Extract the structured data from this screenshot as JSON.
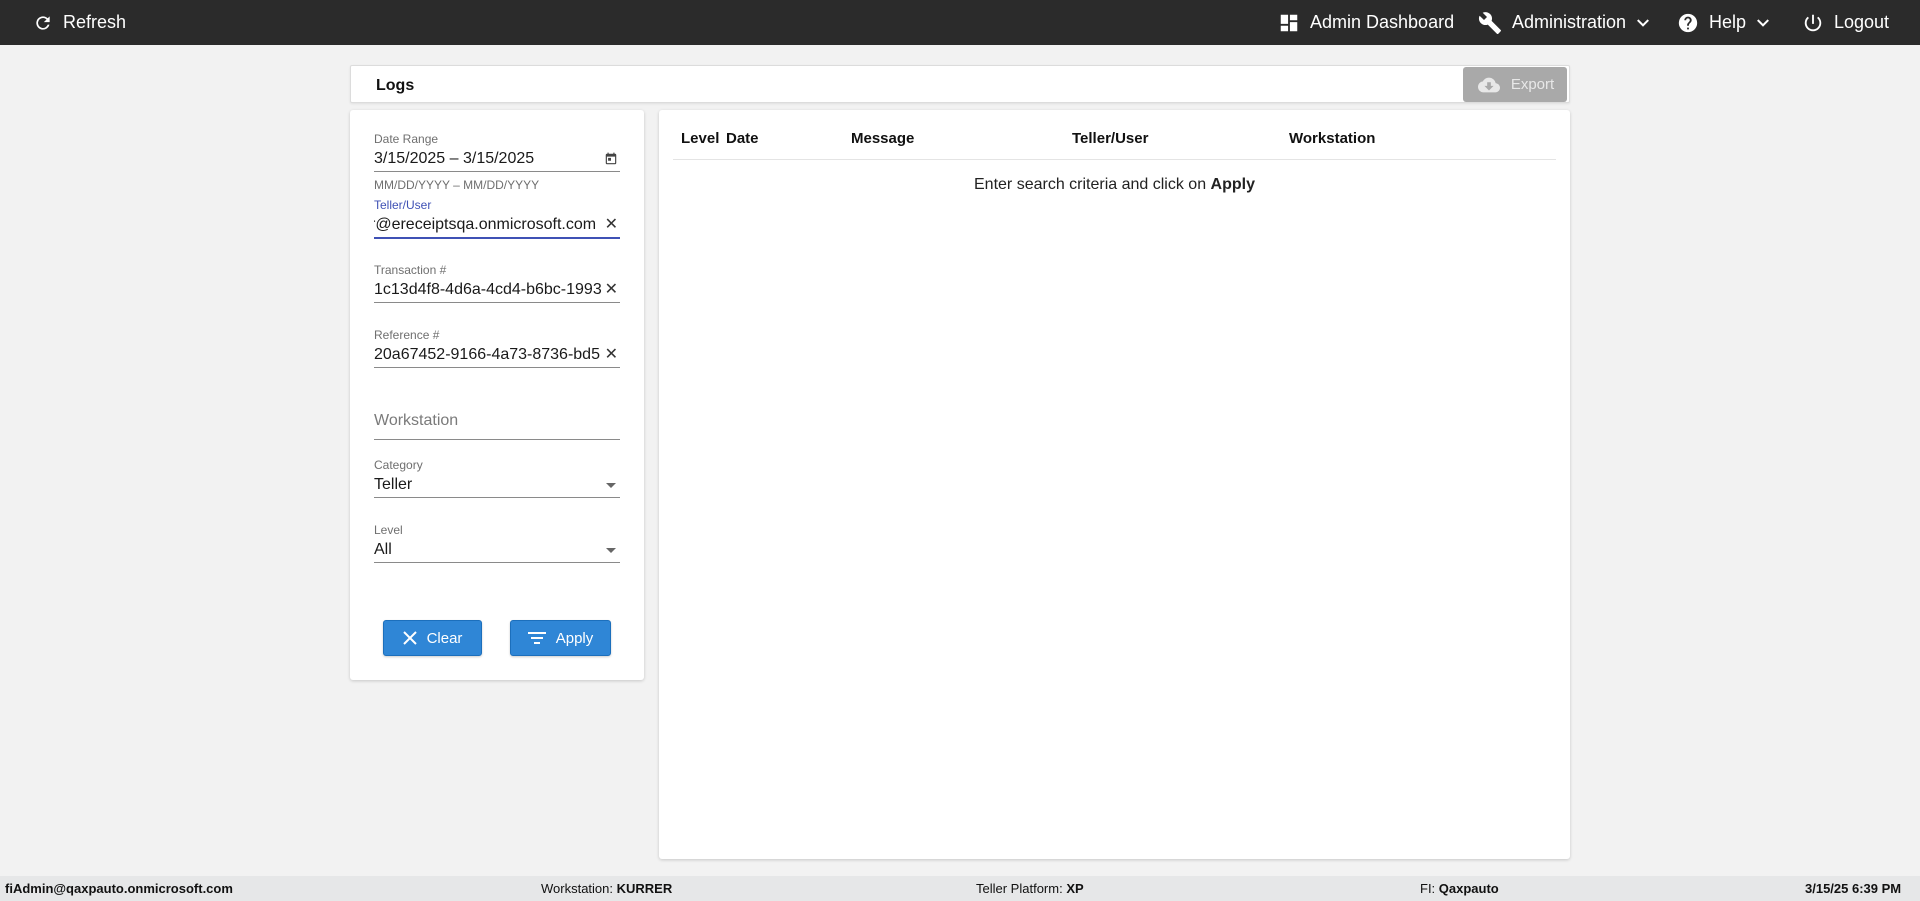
{
  "topbar": {
    "refresh_label": "Refresh",
    "admin_dashboard_label": "Admin Dashboard",
    "administration_label": "Administration",
    "help_label": "Help",
    "logout_label": "Logout"
  },
  "logs": {
    "title": "Logs",
    "export_label": "Export"
  },
  "filters": {
    "date_range": {
      "label": "Date Range",
      "value": "3/15/2025 – 3/15/2025",
      "hint": "MM/DD/YYYY – MM/DD/YYYY"
    },
    "teller_user": {
      "label": "Teller/User",
      "value": "r@ereceiptsqa.onmicrosoft.com"
    },
    "transaction": {
      "label": "Transaction #",
      "value": "1c13d4f8-4d6a-4cd4-b6bc-1993"
    },
    "reference": {
      "label": "Reference #",
      "value": "20a67452-9166-4a73-8736-bd5"
    },
    "workstation": {
      "placeholder": "Workstation"
    },
    "category": {
      "label": "Category",
      "value": "Teller"
    },
    "level": {
      "label": "Level",
      "value": "All"
    },
    "clear_label": "Clear",
    "apply_label": "Apply"
  },
  "results": {
    "columns": [
      "Level",
      "Date",
      "Message",
      "Teller/User",
      "Workstation"
    ],
    "empty_message_prefix": "Enter search criteria and click on ",
    "empty_message_bold": "Apply"
  },
  "status": {
    "user": "fiAdmin@qaxpauto.onmicrosoft.com",
    "workstation_label": "Workstation: ",
    "workstation_value": "KURRER",
    "platform_label": "Teller Platform: ",
    "platform_value": "XP",
    "fi_label": "FI: ",
    "fi_value": "Qaxpauto",
    "datetime": "3/15/25 6:39 PM"
  },
  "colors": {
    "topbar_bg": "#2b2b2b",
    "button_blue": "#2f86d6",
    "focus_blue": "#3f51b5",
    "export_disabled": "#a9a9a9"
  },
  "icons": [
    "refresh-icon",
    "dashboard-icon",
    "wrench-icon",
    "help-icon",
    "chevron-down-icon",
    "power-icon",
    "cloud-download-icon",
    "calendar-icon",
    "close-icon",
    "dropdown-arrow-icon",
    "filter-icon"
  ]
}
